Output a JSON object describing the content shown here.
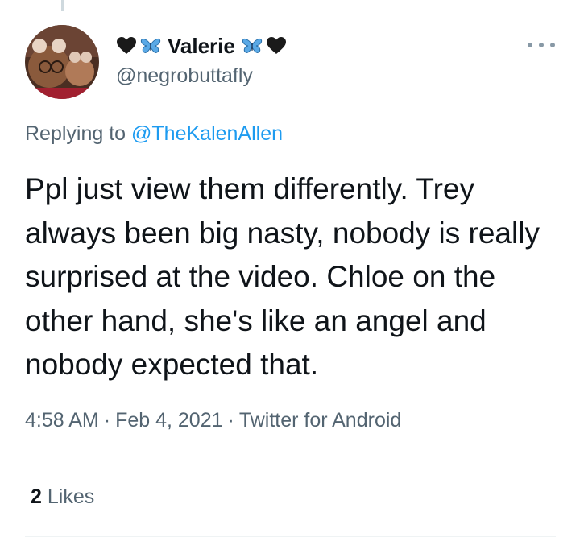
{
  "tweet": {
    "author": {
      "display_name": "Valerie",
      "handle": "@negrobuttafly",
      "name_emojis": [
        "black-heart-icon",
        "butterfly-icon"
      ]
    },
    "reply_prefix": "Replying to",
    "reply_to": "@TheKalenAllen",
    "text": "Ppl just view them differently. Trey always been big nasty, nobody is really surprised at the video. Chloe on the other hand, she's like an angel and nobody expected that.",
    "time": "4:58 AM",
    "date": "Feb 4, 2021",
    "separator": "·",
    "source": "Twitter for Android",
    "likes_count": "2",
    "likes_label": "Likes"
  },
  "colors": {
    "text": "#0f1419",
    "secondary": "#536471",
    "link": "#1d9bf0",
    "butterfly": "#5aa9e6",
    "divider": "#eff3f4"
  }
}
